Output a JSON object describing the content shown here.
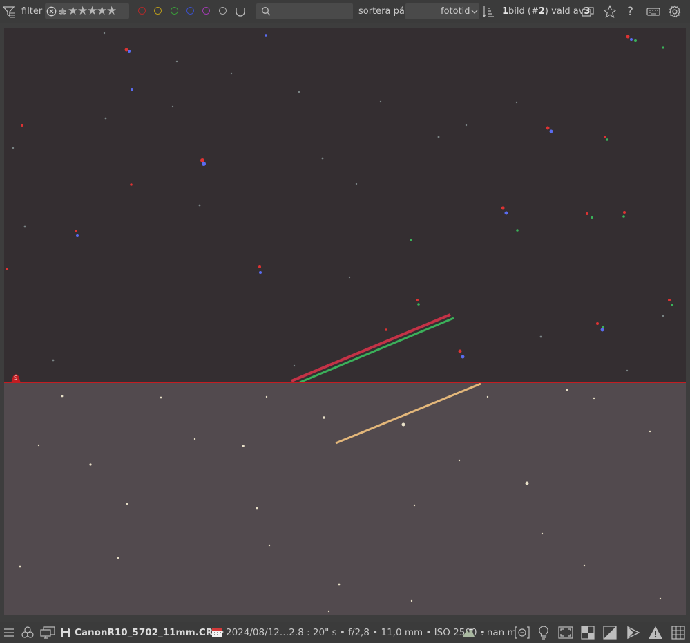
{
  "toolbar": {
    "filter_label": "filter",
    "sort_label": "sortera på",
    "sort_value": "fototid",
    "selection_count": {
      "prefix": "1",
      "text1": " bild (#",
      "num": "2",
      "text2": ") vald av ",
      "total": "3"
    },
    "search_placeholder": "",
    "rating_stars": 5,
    "color_labels": [
      {
        "name": "red",
        "color": "#c0392b"
      },
      {
        "name": "yellow",
        "color": "#c9a227"
      },
      {
        "name": "green",
        "color": "#3a9a3a"
      },
      {
        "name": "blue",
        "color": "#3b4fc4"
      },
      {
        "name": "purple",
        "color": "#a03ab0"
      },
      {
        "name": "gray",
        "color": "#a0a0a0"
      }
    ]
  },
  "viewer": {
    "split_marker_label": "S",
    "split_color": "#c21d22"
  },
  "bottom": {
    "filename": "CanonR10_5702_11mm.CR3",
    "separator": " •",
    "metadata": "2024/08/12…2.8 : 20\" s • f/2,8 • 11,0 mm • ISO 2500 •",
    "elevation": ": nan m"
  }
}
